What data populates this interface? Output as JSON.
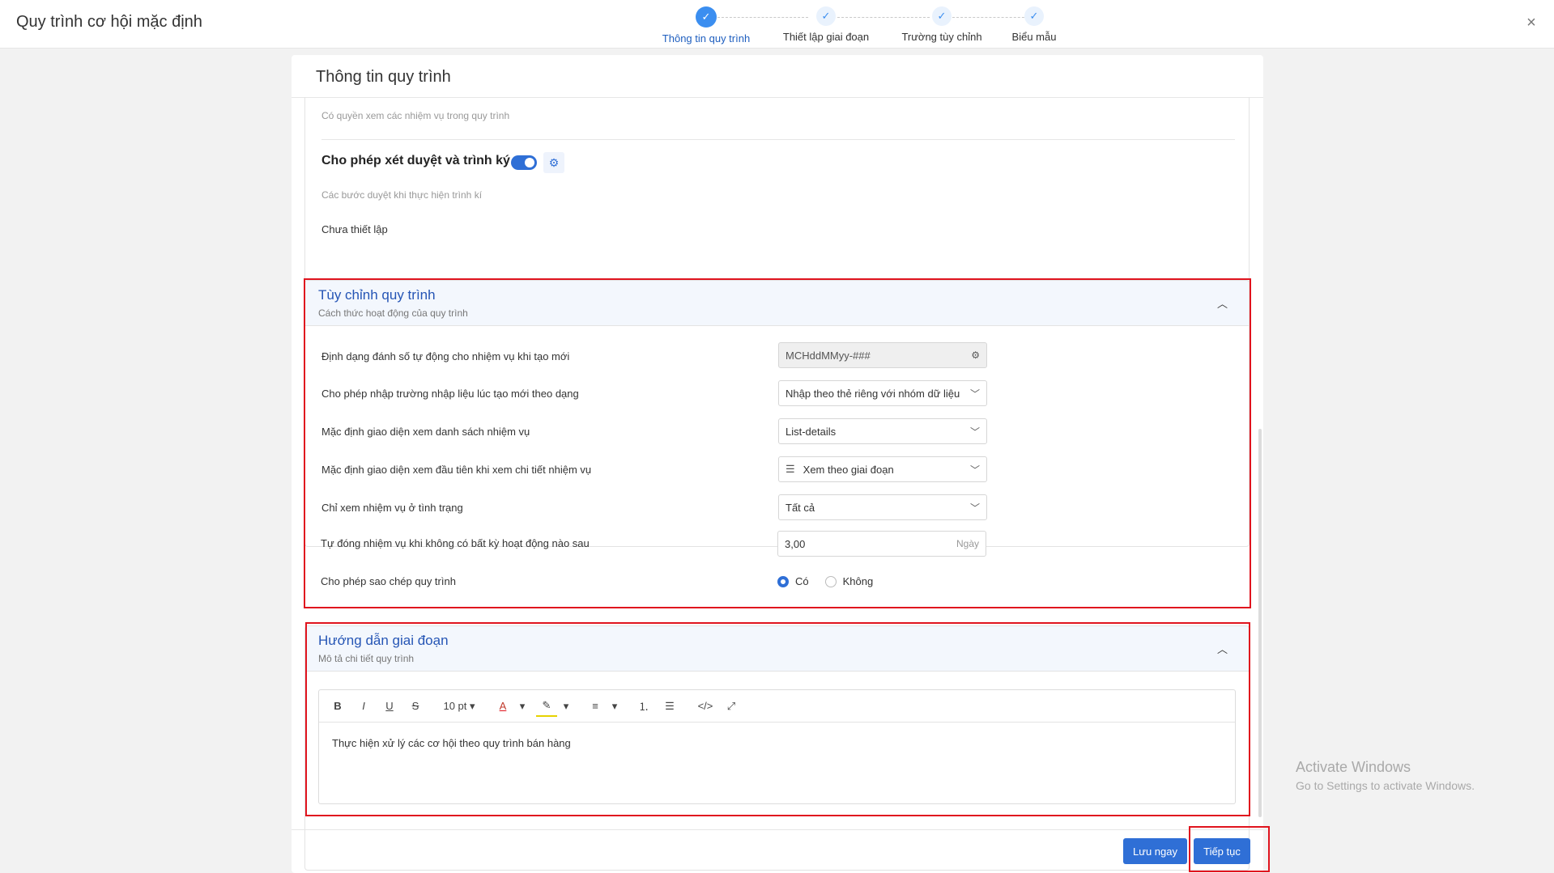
{
  "header": {
    "title": "Quy trình cơ hội mặc định",
    "close_symbol": "×",
    "steps": [
      {
        "label": "Thông tin quy trình",
        "state": "active"
      },
      {
        "label": "Thiết lập giai đoạn",
        "state": "done"
      },
      {
        "label": "Trường tùy chỉnh",
        "state": "done"
      },
      {
        "label": "Biểu mẫu",
        "state": "done"
      }
    ]
  },
  "panel": {
    "title": "Thông tin quy trình",
    "top_hint": "Có quyền xem các nhiệm vụ trong quy trình",
    "approval": {
      "heading": "Cho phép xét duyệt và trình ký",
      "hint": "Các bước duyệt khi thực hiện trình kí",
      "status": "Chưa thiết lập"
    }
  },
  "custom_section": {
    "title": "Tùy chỉnh quy trình",
    "subtitle": "Cách thức hoạt động của quy trình",
    "rows": {
      "numbering": {
        "label": "Định dạng đánh số tự động cho nhiệm vụ khi tạo mới",
        "value": "MCHddMMyy-###"
      },
      "input_mode": {
        "label": "Cho phép nhập trường nhập liệu lúc tạo mới theo dạng",
        "value": "Nhập theo thẻ riêng với nhóm dữ liệu"
      },
      "list_view": {
        "label": "Mặc định giao diện xem danh sách nhiệm vụ",
        "value": "List-details"
      },
      "detail_view": {
        "label": "Mặc định giao diện xem đầu tiên khi xem chi tiết nhiệm vụ",
        "value": "Xem theo giai đoạn"
      },
      "status_filter": {
        "label": "Chỉ xem nhiệm vụ ở tình trạng",
        "value": "Tất cả"
      },
      "auto_close": {
        "label": "Tự đóng nhiệm vụ khi không có bất kỳ hoạt động nào sau",
        "value": "3,00",
        "unit": "Ngày"
      },
      "allow_copy": {
        "label": "Cho phép sao chép quy trình",
        "options": [
          "Có",
          "Không"
        ],
        "selected": "Có"
      }
    }
  },
  "guide_section": {
    "title": "Hướng dẫn giai đoạn",
    "subtitle": "Mô tả chi tiết quy trình",
    "toolbar": {
      "bold": "B",
      "italic": "I",
      "underline": "U",
      "strike": "S",
      "font_size": "10 pt",
      "font_color": "A"
    },
    "content": "Thực hiện xử lý các cơ hội theo quy trình bán hàng"
  },
  "footer": {
    "save_label": "Lưu ngay",
    "continue_label": "Tiếp tục"
  },
  "watermark": {
    "line1": "Activate Windows",
    "line2": "Go to Settings to activate Windows."
  },
  "colors": {
    "accent": "#2f6fd6",
    "highlight_box": "#e0141e"
  }
}
